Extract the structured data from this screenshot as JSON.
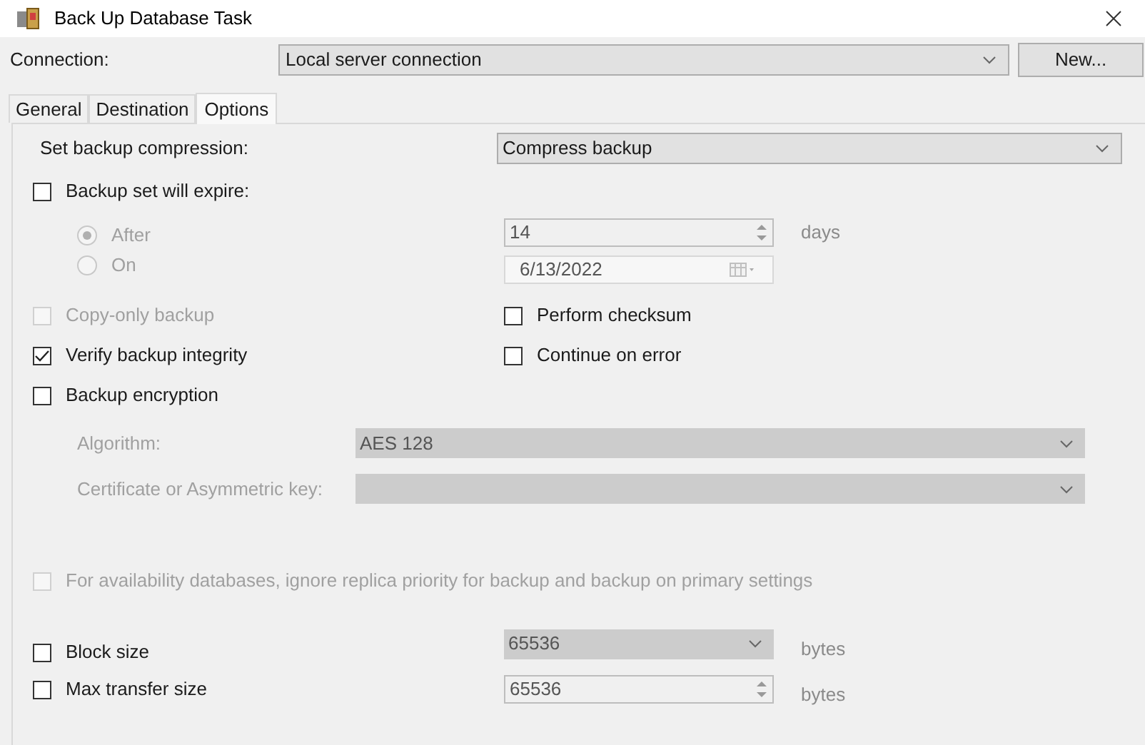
{
  "window": {
    "title": "Back Up Database Task"
  },
  "connection": {
    "label": "Connection:",
    "value": "Local server connection",
    "button": "New..."
  },
  "tabs": [
    {
      "label": "General",
      "selected": false
    },
    {
      "label": "Destination",
      "selected": false
    },
    {
      "label": "Options",
      "selected": true
    }
  ],
  "compression": {
    "label": "Set backup compression:",
    "value": "Compress backup"
  },
  "expire": {
    "label": "Backup set will expire:",
    "checked": false,
    "options": [
      {
        "label": "After",
        "selected": true,
        "kind": "spin",
        "value": "14",
        "unit": "days"
      },
      {
        "label": "On",
        "selected": false,
        "kind": "date",
        "value": "6/13/2022"
      }
    ]
  },
  "option_rows": [
    {
      "left": {
        "label": "Copy-only backup",
        "checked": false,
        "disabled": true
      },
      "right": {
        "label": "Perform checksum",
        "checked": false,
        "disabled": false
      }
    },
    {
      "left": {
        "label": "Verify backup integrity",
        "checked": true,
        "disabled": false
      },
      "right": {
        "label": "Continue on error",
        "checked": false,
        "disabled": false
      }
    },
    {
      "left": {
        "label": "Backup encryption",
        "checked": false,
        "disabled": false
      }
    }
  ],
  "encryption_fields": [
    {
      "label": "Algorithm:",
      "value": "AES 128"
    },
    {
      "label": "Certificate or Asymmetric key:"
    }
  ],
  "availability": {
    "label": "For availability databases, ignore replica priority for backup and backup on primary settings",
    "checked": false,
    "disabled": true
  },
  "sizes": [
    {
      "label": "Block size",
      "checked": false,
      "kind": "combo",
      "value": "65536",
      "unit": "bytes"
    },
    {
      "label": "Max transfer size",
      "checked": false,
      "kind": "spin",
      "value": "65536",
      "unit": "bytes"
    }
  ]
}
